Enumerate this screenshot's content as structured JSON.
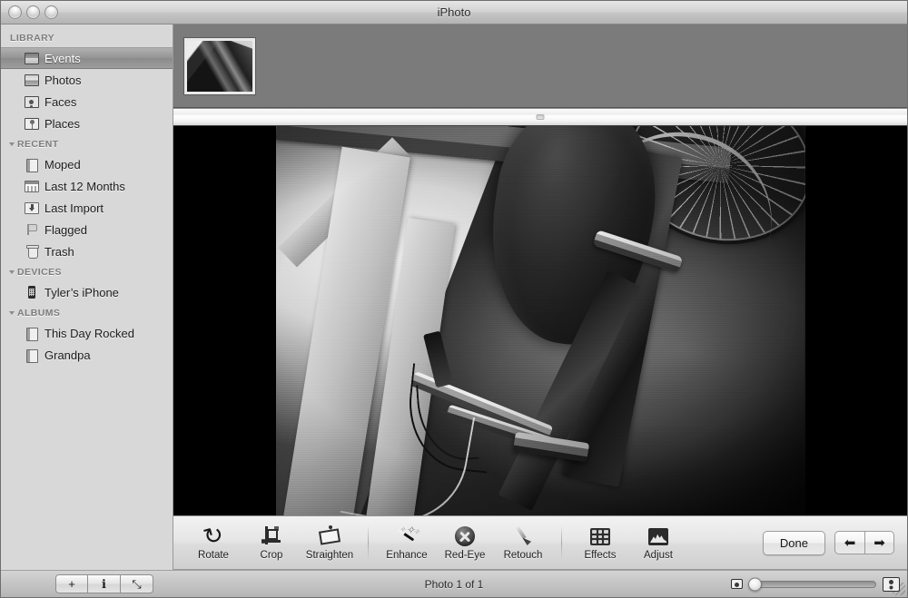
{
  "window": {
    "title": "iPhoto",
    "controls": [
      "close-button",
      "minimize-button",
      "zoom-button"
    ]
  },
  "sidebar": {
    "sections": [
      {
        "header": "LIBRARY",
        "has_disclosure": false,
        "items": [
          {
            "label": "Events",
            "icon": "events-icon",
            "selected": true
          },
          {
            "label": "Photos",
            "icon": "photos-icon",
            "selected": false
          },
          {
            "label": "Faces",
            "icon": "faces-icon",
            "selected": false
          },
          {
            "label": "Places",
            "icon": "places-icon",
            "selected": false
          }
        ]
      },
      {
        "header": "RECENT",
        "has_disclosure": true,
        "items": [
          {
            "label": "Moped",
            "icon": "album-icon",
            "selected": false
          },
          {
            "label": "Last 12 Months",
            "icon": "calendar-icon",
            "selected": false
          },
          {
            "label": "Last Import",
            "icon": "import-icon",
            "selected": false
          },
          {
            "label": "Flagged",
            "icon": "flag-icon",
            "selected": false
          },
          {
            "label": "Trash",
            "icon": "trash-icon",
            "selected": false
          }
        ]
      },
      {
        "header": "DEVICES",
        "has_disclosure": true,
        "items": [
          {
            "label": "Tyler’s iPhone",
            "icon": "iphone-icon",
            "selected": false
          }
        ]
      },
      {
        "header": "ALBUMS",
        "has_disclosure": true,
        "items": [
          {
            "label": "This Day Rocked",
            "icon": "album-icon",
            "selected": false
          },
          {
            "label": "Grandpa",
            "icon": "album-icon",
            "selected": false
          }
        ]
      }
    ]
  },
  "filmstrip": {
    "thumbnails": [
      {
        "name": "photo-thumbnail-1",
        "selected": true
      }
    ]
  },
  "viewer": {
    "background_color": "#000000",
    "photo_alt": "black and white photo of a moped underside with wheel, seat and frame"
  },
  "edit_toolbar": {
    "tools": [
      {
        "label": "Rotate",
        "icon": "rotate-icon"
      },
      {
        "label": "Crop",
        "icon": "crop-icon"
      },
      {
        "label": "Straighten",
        "icon": "straighten-icon"
      },
      {
        "label": "Enhance",
        "icon": "enhance-wand-icon"
      },
      {
        "label": "Red-Eye",
        "icon": "red-eye-icon"
      },
      {
        "label": "Retouch",
        "icon": "retouch-brush-icon"
      },
      {
        "label": "Effects",
        "icon": "effects-grid-icon"
      },
      {
        "label": "Adjust",
        "icon": "adjust-histogram-icon"
      }
    ],
    "done_label": "Done",
    "prev_label": "⬅",
    "next_label": "➡"
  },
  "status_bar": {
    "buttons": [
      {
        "name": "add-button",
        "glyph": "+"
      },
      {
        "name": "info-button",
        "glyph": "ℹ"
      },
      {
        "name": "fullscreen-button",
        "glyph": "⤡"
      }
    ],
    "status_text": "Photo 1 of 1",
    "zoom": {
      "small_icon": "small-thumbnail-icon",
      "large_icon": "large-thumbnail-icon",
      "value": 0
    }
  }
}
